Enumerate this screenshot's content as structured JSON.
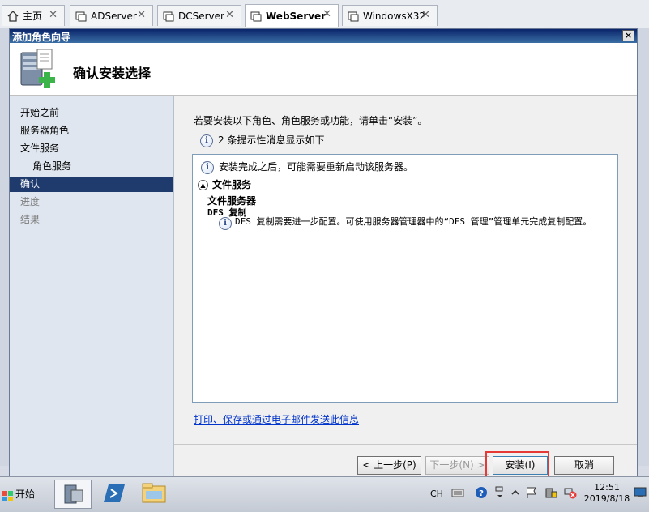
{
  "tabs": [
    {
      "label": "主页",
      "icon": "home-icon",
      "active": false
    },
    {
      "label": "ADServer",
      "icon": "vm-icon",
      "active": false
    },
    {
      "label": "DCServer",
      "icon": "vm-icon",
      "active": false
    },
    {
      "label": "WebServer",
      "icon": "vm-icon",
      "active": true
    },
    {
      "label": "WindowsX32",
      "icon": "vm-icon",
      "active": false
    }
  ],
  "dialog": {
    "title": "添加角色向导",
    "close_glyph": "×",
    "header_title": "确认安装选择"
  },
  "nav": {
    "items": [
      {
        "label": "开始之前",
        "state": "normal"
      },
      {
        "label": "服务器角色",
        "state": "normal"
      },
      {
        "label": "文件服务",
        "state": "normal"
      },
      {
        "label": "角色服务",
        "state": "sub"
      },
      {
        "label": "确认",
        "state": "active"
      },
      {
        "label": "进度",
        "state": "disabled"
      },
      {
        "label": "结果",
        "state": "disabled"
      }
    ]
  },
  "content": {
    "intro": "若要安装以下角色、角色服务或功能，请单击“安装”。",
    "warning_count": "2 条提示性消息显示如下",
    "detail_note": "安装完成之后，可能需要重新启动该服务器。",
    "section_title": "文件服务",
    "role_name": "文件服务器",
    "service_name": "DFS 复制",
    "service_note": "DFS 复制需要进一步配置。可使用服务器管理器中的“DFS 管理”管理单元完成复制配置。",
    "print_link": "打印、保存或通过电子邮件发送此信息"
  },
  "buttons": {
    "prev": "< 上一步(P)",
    "next": "下一步(N) >",
    "install": "安装(I)",
    "cancel": "取消"
  },
  "taskbar": {
    "start_label": "开始",
    "lang": "CH",
    "time": "12:51",
    "date": "2019/8/18"
  },
  "colors": {
    "nav_active_bg": "#1f3a6d",
    "highlight_border": "#e53935",
    "link": "#0033cc"
  }
}
